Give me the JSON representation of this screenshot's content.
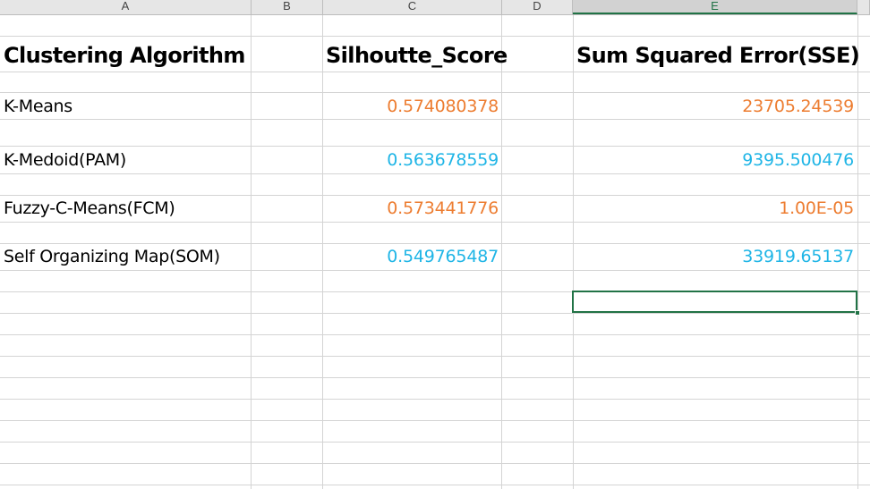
{
  "columns": [
    "A",
    "B",
    "C",
    "D",
    "E"
  ],
  "selected_column": "E",
  "table": {
    "headers": {
      "algorithm": "Clustering Algorithm",
      "silhouette": "Silhoutte_Score",
      "sse": "Sum Squared Error(SSE)"
    },
    "rows": [
      {
        "algorithm": "K-Means",
        "silhouette": "0.574080378",
        "sse": "23705.24539",
        "color": "#ed7d31"
      },
      {
        "algorithm": "K-Medoid(PAM)",
        "silhouette": "0.563678559",
        "sse": "9395.500476",
        "color": "#1fb5e6"
      },
      {
        "algorithm": "Fuzzy-C-Means(FCM)",
        "silhouette": "0.573441776",
        "sse": "1.00E-05",
        "color": "#ed7d31"
      },
      {
        "algorithm": "Self Organizing Map(SOM)",
        "silhouette": "0.549765487",
        "sse": "33919.65137",
        "color": "#1fb5e6"
      }
    ]
  },
  "colors": {
    "accent_green": "#217346",
    "orange": "#ed7d31",
    "blue": "#1fb5e6"
  }
}
